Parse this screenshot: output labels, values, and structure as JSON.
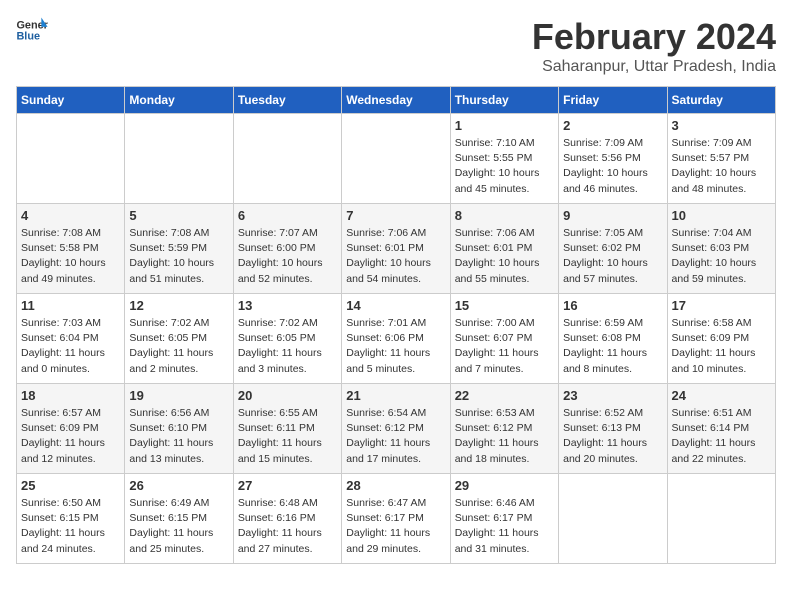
{
  "header": {
    "logo_line1": "General",
    "logo_line2": "Blue",
    "month": "February 2024",
    "location": "Saharanpur, Uttar Pradesh, India"
  },
  "weekdays": [
    "Sunday",
    "Monday",
    "Tuesday",
    "Wednesday",
    "Thursday",
    "Friday",
    "Saturday"
  ],
  "weeks": [
    [
      {
        "day": "",
        "info": ""
      },
      {
        "day": "",
        "info": ""
      },
      {
        "day": "",
        "info": ""
      },
      {
        "day": "",
        "info": ""
      },
      {
        "day": "1",
        "info": "Sunrise: 7:10 AM\nSunset: 5:55 PM\nDaylight: 10 hours\nand 45 minutes."
      },
      {
        "day": "2",
        "info": "Sunrise: 7:09 AM\nSunset: 5:56 PM\nDaylight: 10 hours\nand 46 minutes."
      },
      {
        "day": "3",
        "info": "Sunrise: 7:09 AM\nSunset: 5:57 PM\nDaylight: 10 hours\nand 48 minutes."
      }
    ],
    [
      {
        "day": "4",
        "info": "Sunrise: 7:08 AM\nSunset: 5:58 PM\nDaylight: 10 hours\nand 49 minutes."
      },
      {
        "day": "5",
        "info": "Sunrise: 7:08 AM\nSunset: 5:59 PM\nDaylight: 10 hours\nand 51 minutes."
      },
      {
        "day": "6",
        "info": "Sunrise: 7:07 AM\nSunset: 6:00 PM\nDaylight: 10 hours\nand 52 minutes."
      },
      {
        "day": "7",
        "info": "Sunrise: 7:06 AM\nSunset: 6:01 PM\nDaylight: 10 hours\nand 54 minutes."
      },
      {
        "day": "8",
        "info": "Sunrise: 7:06 AM\nSunset: 6:01 PM\nDaylight: 10 hours\nand 55 minutes."
      },
      {
        "day": "9",
        "info": "Sunrise: 7:05 AM\nSunset: 6:02 PM\nDaylight: 10 hours\nand 57 minutes."
      },
      {
        "day": "10",
        "info": "Sunrise: 7:04 AM\nSunset: 6:03 PM\nDaylight: 10 hours\nand 59 minutes."
      }
    ],
    [
      {
        "day": "11",
        "info": "Sunrise: 7:03 AM\nSunset: 6:04 PM\nDaylight: 11 hours\nand 0 minutes."
      },
      {
        "day": "12",
        "info": "Sunrise: 7:02 AM\nSunset: 6:05 PM\nDaylight: 11 hours\nand 2 minutes."
      },
      {
        "day": "13",
        "info": "Sunrise: 7:02 AM\nSunset: 6:05 PM\nDaylight: 11 hours\nand 3 minutes."
      },
      {
        "day": "14",
        "info": "Sunrise: 7:01 AM\nSunset: 6:06 PM\nDaylight: 11 hours\nand 5 minutes."
      },
      {
        "day": "15",
        "info": "Sunrise: 7:00 AM\nSunset: 6:07 PM\nDaylight: 11 hours\nand 7 minutes."
      },
      {
        "day": "16",
        "info": "Sunrise: 6:59 AM\nSunset: 6:08 PM\nDaylight: 11 hours\nand 8 minutes."
      },
      {
        "day": "17",
        "info": "Sunrise: 6:58 AM\nSunset: 6:09 PM\nDaylight: 11 hours\nand 10 minutes."
      }
    ],
    [
      {
        "day": "18",
        "info": "Sunrise: 6:57 AM\nSunset: 6:09 PM\nDaylight: 11 hours\nand 12 minutes."
      },
      {
        "day": "19",
        "info": "Sunrise: 6:56 AM\nSunset: 6:10 PM\nDaylight: 11 hours\nand 13 minutes."
      },
      {
        "day": "20",
        "info": "Sunrise: 6:55 AM\nSunset: 6:11 PM\nDaylight: 11 hours\nand 15 minutes."
      },
      {
        "day": "21",
        "info": "Sunrise: 6:54 AM\nSunset: 6:12 PM\nDaylight: 11 hours\nand 17 minutes."
      },
      {
        "day": "22",
        "info": "Sunrise: 6:53 AM\nSunset: 6:12 PM\nDaylight: 11 hours\nand 18 minutes."
      },
      {
        "day": "23",
        "info": "Sunrise: 6:52 AM\nSunset: 6:13 PM\nDaylight: 11 hours\nand 20 minutes."
      },
      {
        "day": "24",
        "info": "Sunrise: 6:51 AM\nSunset: 6:14 PM\nDaylight: 11 hours\nand 22 minutes."
      }
    ],
    [
      {
        "day": "25",
        "info": "Sunrise: 6:50 AM\nSunset: 6:15 PM\nDaylight: 11 hours\nand 24 minutes."
      },
      {
        "day": "26",
        "info": "Sunrise: 6:49 AM\nSunset: 6:15 PM\nDaylight: 11 hours\nand 25 minutes."
      },
      {
        "day": "27",
        "info": "Sunrise: 6:48 AM\nSunset: 6:16 PM\nDaylight: 11 hours\nand 27 minutes."
      },
      {
        "day": "28",
        "info": "Sunrise: 6:47 AM\nSunset: 6:17 PM\nDaylight: 11 hours\nand 29 minutes."
      },
      {
        "day": "29",
        "info": "Sunrise: 6:46 AM\nSunset: 6:17 PM\nDaylight: 11 hours\nand 31 minutes."
      },
      {
        "day": "",
        "info": ""
      },
      {
        "day": "",
        "info": ""
      }
    ]
  ]
}
